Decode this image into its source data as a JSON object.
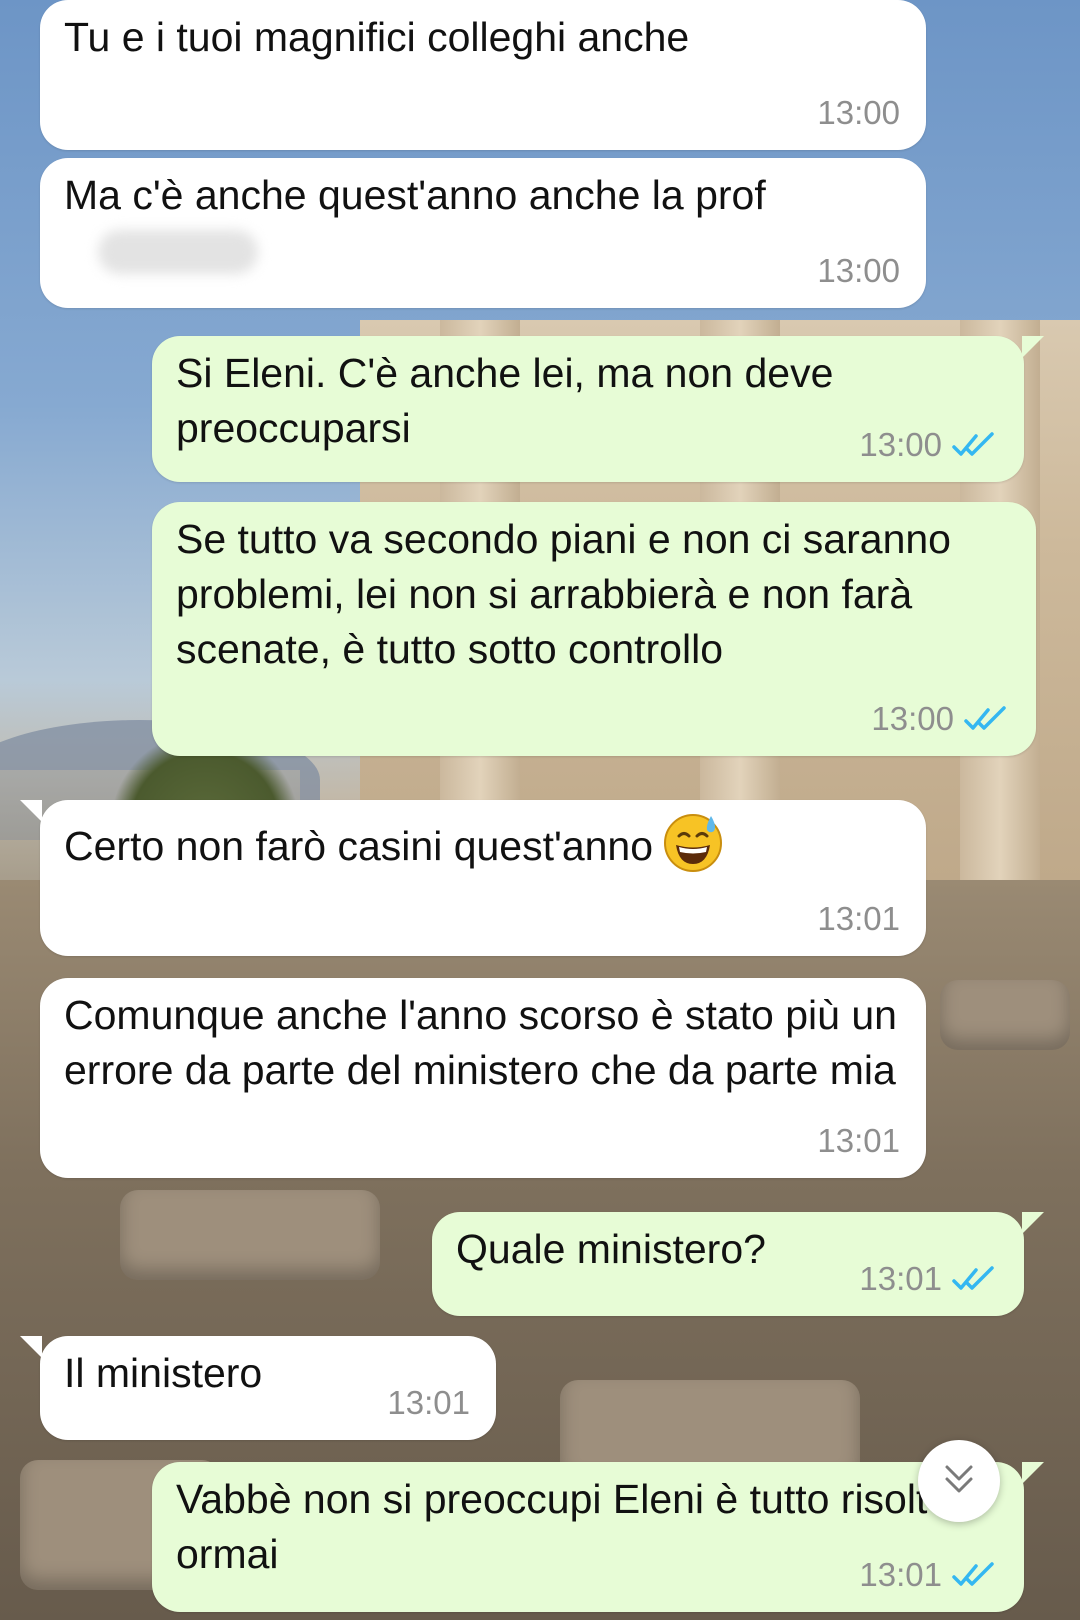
{
  "accent": {
    "incoming_bg": "#ffffff",
    "outgoing_bg": "#e7fcd6",
    "read_ticks": "#34b7f1"
  },
  "messages": [
    {
      "direction": "in",
      "text": "Tu e i tuoi magnifici colleghi anche",
      "time": "13:00"
    },
    {
      "direction": "in",
      "text": "Ma c'è anche quest'anno anche la prof",
      "time": "13:00",
      "redacted": "blurred-name"
    },
    {
      "direction": "out",
      "text": "Si Eleni. C'è anche lei, ma non deve preoccuparsi",
      "time": "13:00",
      "status": "read"
    },
    {
      "direction": "out",
      "text": "Se tutto va secondo piani e non ci saranno problemi, lei non si arrabbierà e non farà scenate, è tutto sotto controllo",
      "time": "13:00",
      "status": "read"
    },
    {
      "direction": "in",
      "text": "Certo non farò casini quest'anno",
      "emoji": "grinning-face-with-sweat-icon",
      "time": "13:01"
    },
    {
      "direction": "in",
      "text": "Comunque anche l'anno scorso è stato più un errore da parte del ministero che da parte mia",
      "time": "13:01"
    },
    {
      "direction": "out",
      "text": "Quale ministero?",
      "time": "13:01",
      "status": "read"
    },
    {
      "direction": "in",
      "text": "Il ministero",
      "time": "13:01"
    },
    {
      "direction": "out",
      "text": "Vabbè non si preoccupi Eleni è tutto risolto ormai",
      "time": "13:01",
      "status": "read"
    }
  ],
  "scroll_button": {
    "icon": "double-chevron-down-icon"
  }
}
